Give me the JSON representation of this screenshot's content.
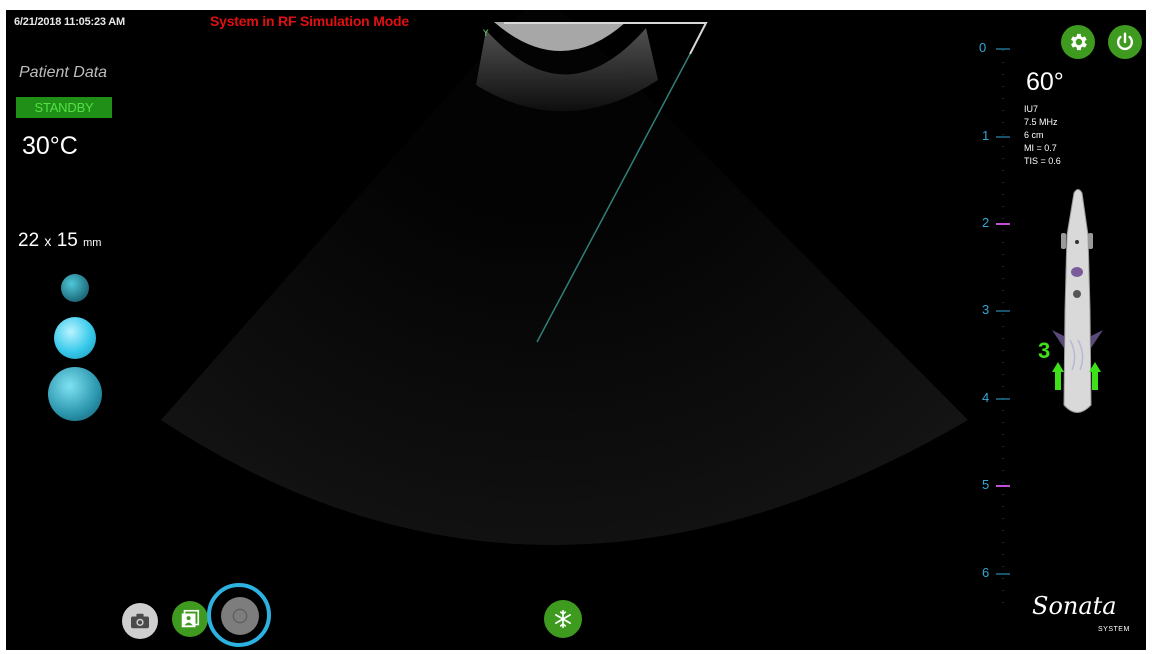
{
  "header": {
    "timestamp": "6/21/2018 11:05:23 AM",
    "mode_banner": "System in RF Simulation Mode"
  },
  "left_panel": {
    "patient_label": "Patient Data",
    "status_badge": "STANDBY",
    "temperature": "30°C",
    "dimension_w": "22",
    "dimension_x": "x",
    "dimension_h": "15",
    "dimension_unit": "mm"
  },
  "right_panel": {
    "angle": "60°",
    "specs": [
      "IU7",
      "7.5 MHz",
      "6 cm",
      "MI = 0.7",
      "TIS = 0.6"
    ],
    "depth_scale": [
      "0",
      "1",
      "2",
      "3",
      "4",
      "5",
      "6"
    ],
    "handpiece_count": "3"
  },
  "logo": {
    "name": "Sonata",
    "subtitle": "SYSTEM"
  },
  "colors": {
    "accent_green": "#3f9a20",
    "banner_red": "#e01010",
    "scale_blue": "#34a7d6",
    "ring_blue": "#2cb1e0"
  },
  "icons": {
    "settings": "gear-icon",
    "power": "power-icon",
    "camera": "camera-icon",
    "gallery": "gallery-icon",
    "record": "record-icon",
    "freeze": "snowflake-icon"
  }
}
